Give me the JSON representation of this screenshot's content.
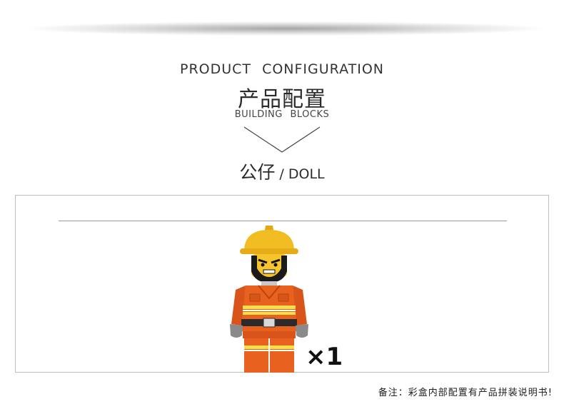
{
  "header": {
    "title_en": "PRODUCT CONFIGURATION",
    "title_cn": "产品配置",
    "subtitle_en": "BUILDING BLOCKS"
  },
  "section": {
    "name_cn": "公仔",
    "separator": " / ",
    "name_en": "DOLL"
  },
  "item": {
    "quantity": "×1",
    "figure_colors": {
      "helmet": "#f2bd22",
      "suit": "#e8611e",
      "reflective_stripe": "#f5e04a",
      "hands": "#8a8a8a"
    }
  },
  "footer": {
    "note": "备注：彩盒内部配置有产品拼装说明书!"
  }
}
